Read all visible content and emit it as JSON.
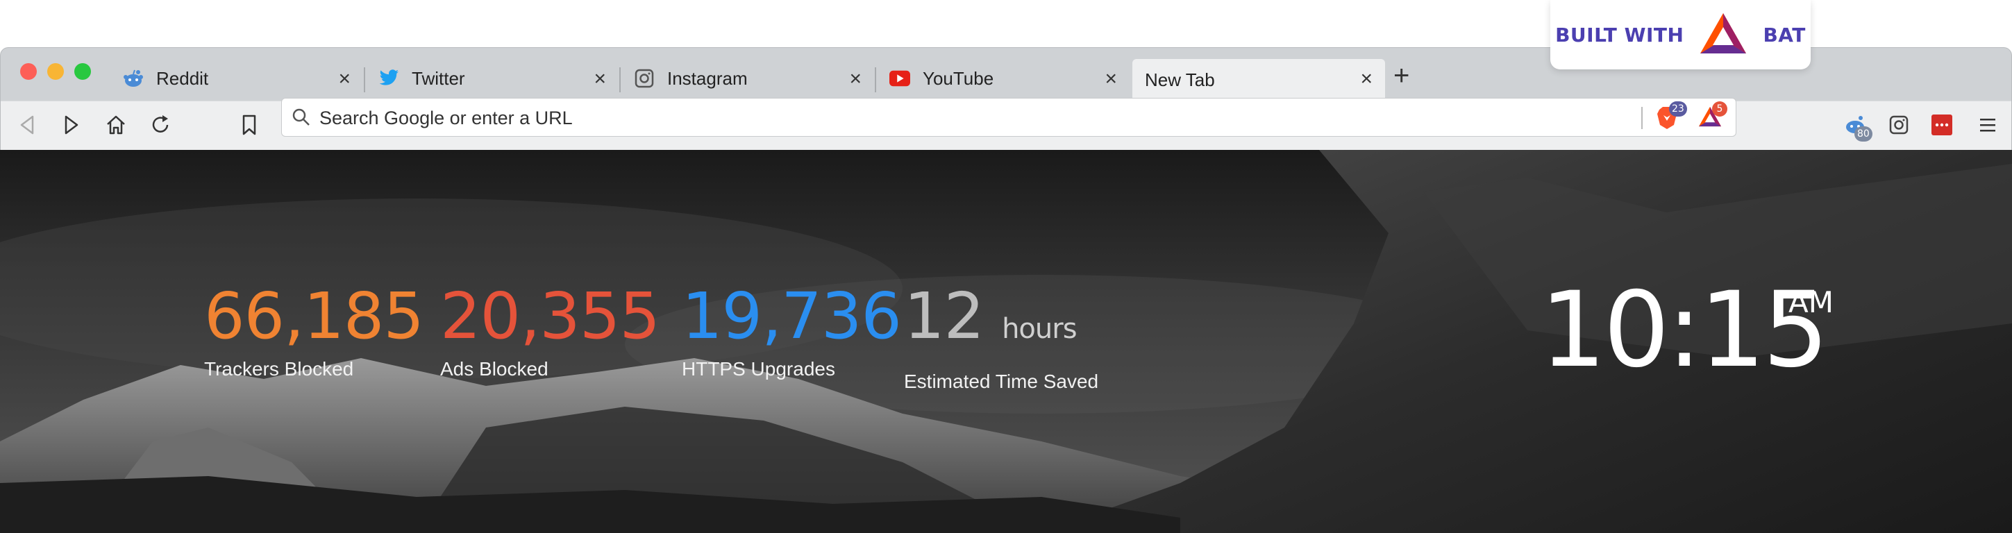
{
  "badge": {
    "built_with": "BUILT WITH",
    "brand": "BAT"
  },
  "tabs": [
    {
      "label": "Reddit",
      "icon": "reddit-icon"
    },
    {
      "label": "Twitter",
      "icon": "twitter-icon"
    },
    {
      "label": "Instagram",
      "icon": "instagram-icon"
    },
    {
      "label": "YouTube",
      "icon": "youtube-icon"
    },
    {
      "label": "New Tab",
      "icon": "",
      "active": true
    }
  ],
  "toolbar": {
    "url_placeholder": "Search Google or enter a URL",
    "brave_shield_count": "23",
    "bat_rewards_count": "5",
    "reddit_ext_count": "80"
  },
  "stats": {
    "trackers": {
      "value": "66,185",
      "label": "Trackers Blocked",
      "color": "#f08332"
    },
    "ads": {
      "value": "20,355",
      "label": "Ads Blocked",
      "color": "#e5533a"
    },
    "https": {
      "value": "19,736",
      "label": "HTTPS Upgrades",
      "color": "#2a8ef0"
    },
    "time": {
      "value": "12",
      "unit": "hours",
      "label": "Estimated Time Saved",
      "color": "#bdbdbd"
    }
  },
  "clock": {
    "time": "10:15",
    "ampm": "AM"
  },
  "colors": {
    "brand_purple": "#4b3fb0",
    "accent_orange": "#f08332"
  }
}
